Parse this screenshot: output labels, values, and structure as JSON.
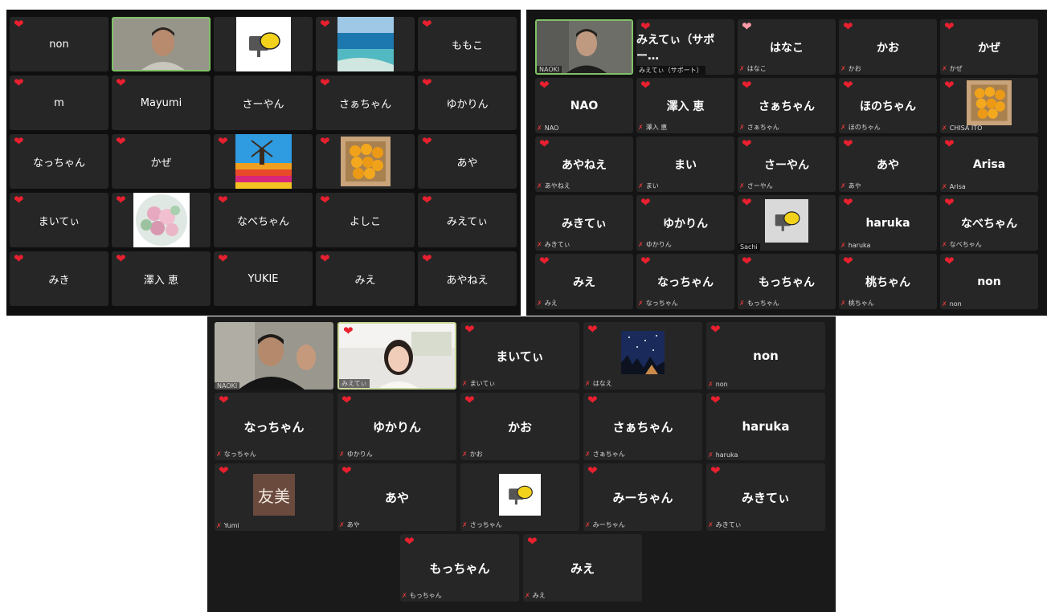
{
  "colors": {
    "heart": "#e8202f",
    "active_border": "#7fc266",
    "tile": "#262626",
    "panel": "#0f0f0f"
  },
  "panel1": {
    "tiles": [
      "non",
      "NAOKI_VIDEO",
      "IMG_LEMON",
      "IMG_BEACH",
      "ももこ",
      "m",
      "Mayumi",
      "さーやん",
      "さぁちゃん",
      "ゆかりん",
      "なっちゃん",
      "かぜ",
      "IMG_TULIP",
      "IMG_ORANGES",
      "あや",
      "まいてぃ",
      "IMG_FLOWERS",
      "なべちゃん",
      "よしこ",
      "みえてぃ",
      "みき",
      "澤入 恵",
      "YUKIE",
      "みえ",
      "あやねえ"
    ]
  },
  "panel2": {
    "names": [
      "",
      "みえてぃ（サポー…",
      "はなこ",
      "かお",
      "かぜ",
      "NAO",
      "澤入 恵",
      "さぁちゃん",
      "ほのちゃん",
      "",
      "あやねえ",
      "まい",
      "さーやん",
      "あや",
      "Arisa",
      "みきてぃ",
      "ゆかりん",
      "",
      "haruka",
      "なべちゃん",
      "みえ",
      "なっちゃん",
      "もっちゃん",
      "桃ちゃん",
      "non"
    ],
    "labels": [
      "NAOKI",
      "みえてぃ（サポート）",
      "はなこ",
      "かお",
      "かぜ",
      "NAO",
      "澤入 恵",
      "さぁちゃん",
      "ほのちゃん",
      "CHISA ITO",
      "あやねえ",
      "まい",
      "さーやん",
      "あや",
      "Arisa",
      "みきてぃ",
      "ゆかりん",
      "Sachi",
      "haruka",
      "なべちゃん",
      "みえ",
      "なっちゃん",
      "もっちゃん",
      "桃ちゃん",
      "non"
    ]
  },
  "panel3": {
    "names": [
      "",
      "",
      "まいてぃ",
      "",
      "non",
      "なっちゃん",
      "ゆかりん",
      "かお",
      "さぁちゃん",
      "haruka",
      "",
      "あや",
      "",
      "みーちゃん",
      "みきてぃ",
      "もっちゃん",
      "みえ"
    ],
    "labels": [
      "NAOKI",
      "みえてぃ",
      "まいてぃ",
      "はなえ",
      "non",
      "なっちゃん",
      "ゆかりん",
      "かお",
      "さぁちゃん",
      "haruka",
      "Yumi",
      "あや",
      "さっちゃん",
      "みーちゃん",
      "みきてぃ",
      "もっちゃん",
      "みえ"
    ],
    "avatar_text": "友美"
  }
}
